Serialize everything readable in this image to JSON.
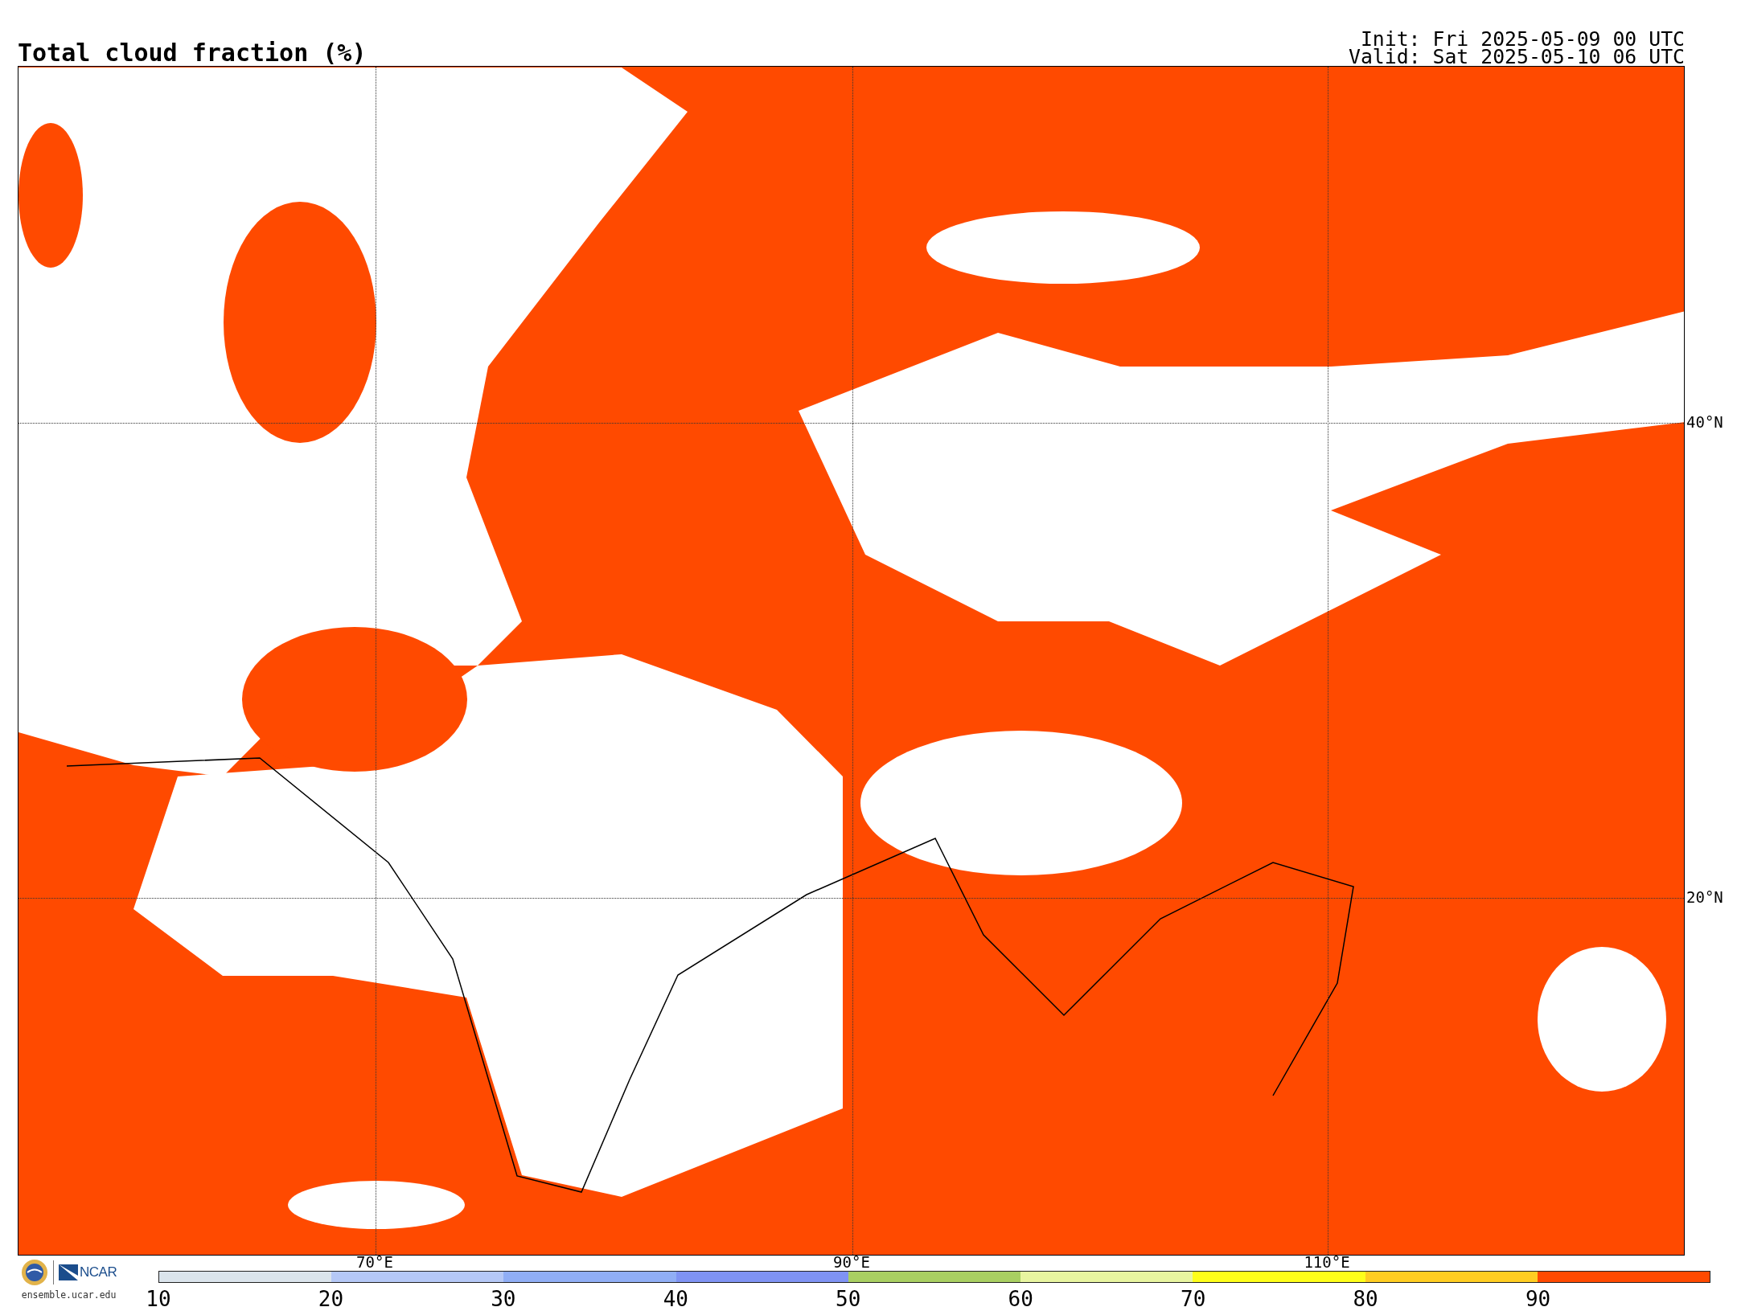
{
  "title": "Total cloud fraction (%)",
  "init": "Init: Fri 2025-05-09 00 UTC",
  "valid": "Valid: Sat 2025-05-10 06 UTC",
  "map": {
    "latitude_labels": [
      "40°N",
      "20°N"
    ],
    "longitude_labels": [
      "70°E",
      "90°E",
      "110°E"
    ]
  },
  "logo": {
    "text": "NCAR",
    "url": "ensemble.ucar.edu"
  },
  "colorbar": {
    "ticks": [
      "10",
      "20",
      "30",
      "40",
      "50",
      "60",
      "70",
      "80",
      "90"
    ],
    "segments": [
      {
        "color": "#dbe4ec"
      },
      {
        "color": "#b5c8f6"
      },
      {
        "color": "#90aef5"
      },
      {
        "color": "#7f93f3"
      },
      {
        "color": "#a9cf62"
      },
      {
        "color": "#e8f5a0"
      },
      {
        "color": "#fefe1a"
      },
      {
        "color": "#ffcd22"
      },
      {
        "color": "#ff4a00"
      }
    ]
  }
}
